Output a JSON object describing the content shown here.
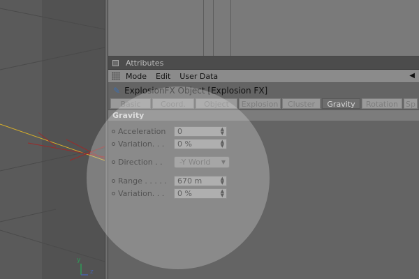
{
  "attributes": {
    "title": "Attributes",
    "menu": [
      "Mode",
      "Edit",
      "User Data"
    ],
    "object_name": "ExplosionFX Object [Explosion FX]",
    "tabs": [
      {
        "label": "Basic",
        "active": false
      },
      {
        "label": "Coord.",
        "active": false
      },
      {
        "label": "Object",
        "active": false
      },
      {
        "label": "Explosion",
        "active": false
      },
      {
        "label": "Cluster",
        "active": false
      },
      {
        "label": "Gravity",
        "active": true
      },
      {
        "label": "Rotation",
        "active": false
      },
      {
        "label": "Sp",
        "active": false
      }
    ],
    "section": "Gravity",
    "params": {
      "acceleration": {
        "label": "Acceleration",
        "value": "0"
      },
      "variation1": {
        "label": "Variation. . .",
        "value": "0 %"
      },
      "direction": {
        "label": "Direction . .",
        "value": "-Y World"
      },
      "range": {
        "label": "Range . . . . .",
        "value": "670 m"
      },
      "variation2": {
        "label": "Variation. . .",
        "value": "0 %"
      }
    }
  },
  "viewport": {
    "axis_labels": {
      "y": "y",
      "z": "z"
    }
  },
  "colors": {
    "accent_active_tab": "#6e6e6e",
    "object_icon": "#3c6fb0",
    "trajectory_yellow": "#d8b02a",
    "trajectory_red": "#9a2a2a"
  }
}
